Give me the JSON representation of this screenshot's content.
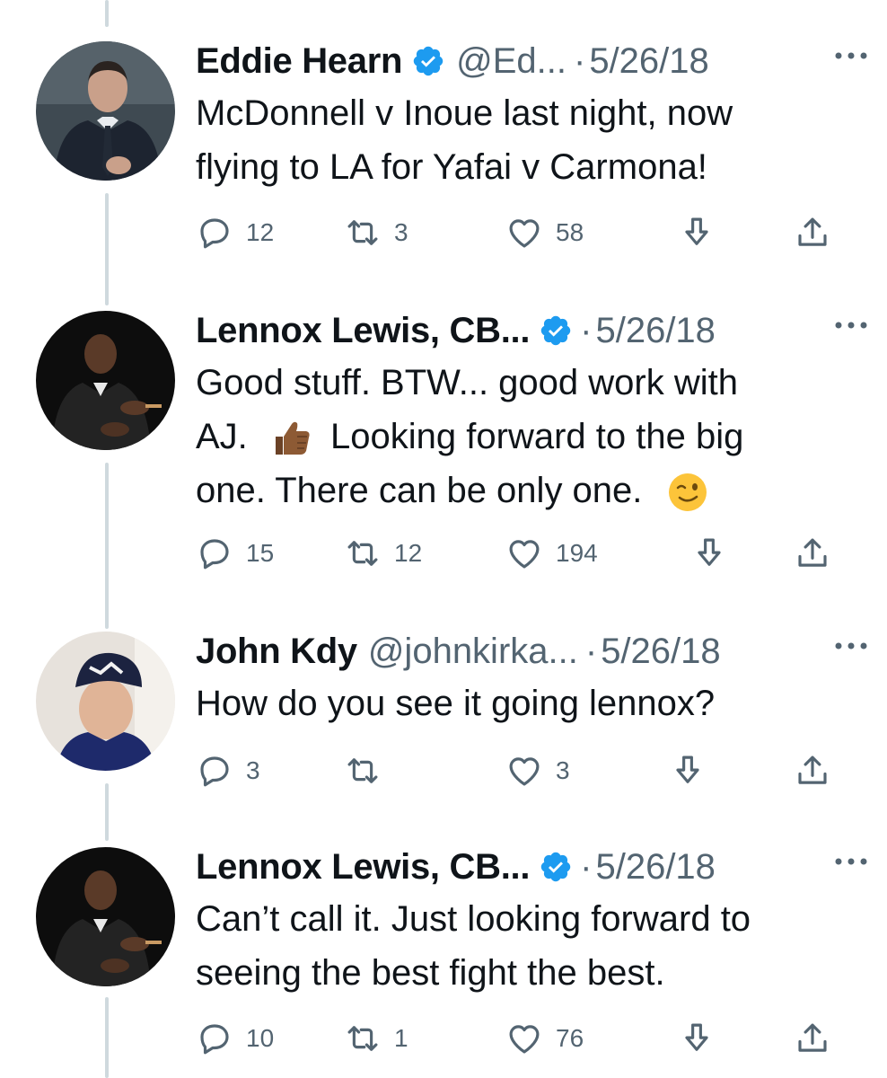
{
  "tweets": [
    {
      "name": "Eddie Hearn",
      "handle": "@Ed...",
      "separator": "·",
      "date": "5/26/18",
      "text_lines": [
        "McDonnell v Inoue last night, now",
        "flying to LA for Yafai v Carmona!"
      ],
      "replies": "12",
      "retweets": "3",
      "likes": "58",
      "verified": true
    },
    {
      "name": "Lennox Lewis, CB...",
      "handle": "",
      "separator": "·",
      "date": "5/26/18",
      "text_lines": [
        "Good stuff. BTW... good work with",
        "AJ.",
        "Looking forward to the big",
        "one. There can be only one."
      ],
      "replies": "15",
      "retweets": "12",
      "likes": "194",
      "verified": true
    },
    {
      "name": "John Kdy",
      "handle": "@johnkirka...",
      "separator": "·",
      "date": "5/26/18",
      "text_lines": [
        "How do you see it going lennox?"
      ],
      "replies": "3",
      "retweets": "",
      "likes": "3",
      "verified": false
    },
    {
      "name": "Lennox Lewis, CB...",
      "handle": "",
      "separator": "·",
      "date": "5/26/18",
      "text_lines": [
        "Can’t call it. Just looking forward to",
        "seeing the best fight the best."
      ],
      "replies": "10",
      "retweets": "1",
      "likes": "76",
      "verified": true
    }
  ],
  "icons": {
    "reply": "reply-bubble-icon",
    "retweet": "retweet-arrows-icon",
    "like": "heart-icon",
    "download": "download-arrow-icon",
    "share": "share-upload-icon",
    "verified": "verified-badge-icon",
    "more": "more-dots-icon"
  },
  "colors": {
    "text": "#0f1419",
    "secondary": "#536471",
    "verified": "#1d9bf0",
    "thread_line": "#cfd9de"
  }
}
